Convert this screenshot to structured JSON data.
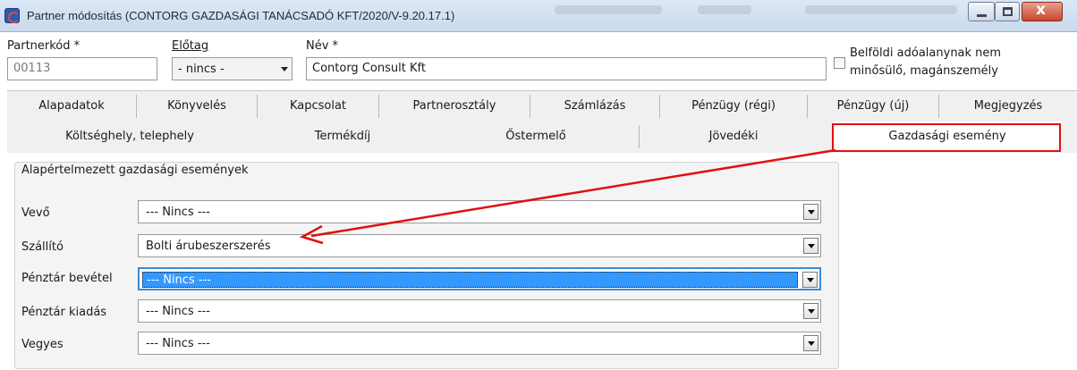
{
  "window": {
    "title": "Partner módosítás (CONTORG GAZDASÁGI TANÁCSADÓ KFT/2020/V-9.20.17.1)"
  },
  "header": {
    "partner_code_label": "Partnerkód *",
    "partner_code_value": "00113",
    "prefix_label": "Előtag",
    "prefix_value": "- nincs -",
    "name_label": "Név *",
    "name_value": "Contorg Consult Kft",
    "checkbox_label_line1": "Belföldi adóalanynak nem",
    "checkbox_label_line2": "minősülő, magánszemély",
    "checkbox_checked": false
  },
  "tabs_row1": [
    "Alapadatok",
    "Könyvelés",
    "Kapcsolat",
    "Partnerosztály",
    "Számlázás",
    "Pénzügy (régi)",
    "Pénzügy (új)",
    "Megjegyzés"
  ],
  "tabs_row2": [
    "Költséghely, telephely",
    "Termékdíj",
    "Őstermelő",
    "Jövedéki",
    "Gazdasági esemény"
  ],
  "active_tab": "Gazdasági esemény",
  "group": {
    "title": "Alapértelmezett gazdasági események",
    "rows": [
      {
        "label": "Vevő",
        "value": "--- Nincs ---"
      },
      {
        "label": "Szállító",
        "value": "Bolti árubeszerszerés"
      },
      {
        "label": "Pénztár bevétel",
        "value": "--- Nincs ---"
      },
      {
        "label": "Pénztár kiadás",
        "value": "--- Nincs ---"
      },
      {
        "label": "Vegyes",
        "value": "--- Nincs ---"
      }
    ]
  },
  "colors": {
    "annotation_red": "#e01010",
    "selection_blue": "#3399ff"
  }
}
